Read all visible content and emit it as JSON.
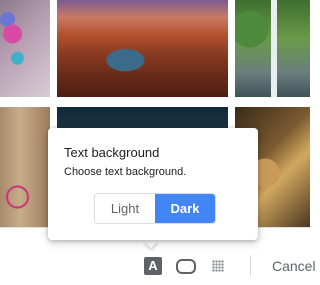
{
  "popup": {
    "title": "Text background",
    "subtitle": "Choose text background.",
    "options": [
      {
        "label": "Light",
        "selected": false
      },
      {
        "label": "Dark",
        "selected": true
      }
    ],
    "selected_color": "#4285f4"
  },
  "toolbar": {
    "text_background_glyph": "A",
    "text_background_icon": "text-background-icon",
    "bubble_icon": "speech-bubble-icon",
    "grid_icon": "dot-grid-icon",
    "cancel_label": "Cancel"
  },
  "thumbnails": [
    {
      "icon": "photo-flowers"
    },
    {
      "icon": "photo-canyon"
    },
    {
      "icon": "photo-waterfall"
    },
    {
      "icon": "photo-doorway"
    },
    {
      "icon": "photo-branches"
    },
    {
      "icon": "photo-chess"
    }
  ]
}
